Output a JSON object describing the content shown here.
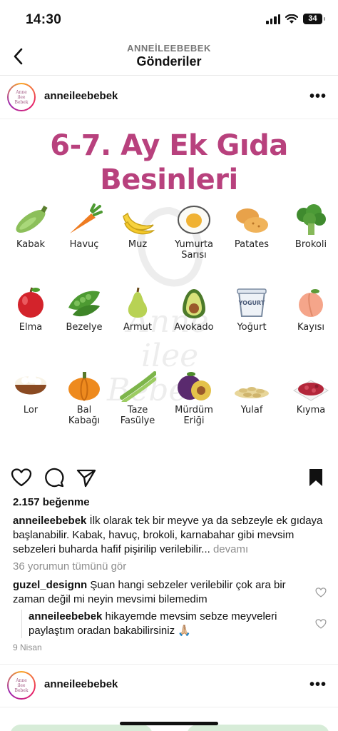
{
  "status": {
    "time": "14:30",
    "battery": "34"
  },
  "nav": {
    "account": "ANNEİLEEBEBEK",
    "title": "Gönderiler"
  },
  "post": {
    "username": "anneileebebek",
    "more_icon": "•••",
    "avatar_text": [
      "Anne",
      "ilee",
      "Bebek"
    ],
    "image": {
      "title_line1": "6-7. Ay Ek Gıda",
      "title_line2": "Besinleri",
      "watermark": [
        "Anne",
        "ilee",
        "Bebek"
      ],
      "foods": [
        {
          "label": "Kabak",
          "icon": "zucchini-icon"
        },
        {
          "label": "Havuç",
          "icon": "carrot-icon"
        },
        {
          "label": "Muz",
          "icon": "banana-icon"
        },
        {
          "label": "Yumurta\nSarısı",
          "icon": "egg-icon"
        },
        {
          "label": "Patates",
          "icon": "potato-icon"
        },
        {
          "label": "Brokoli",
          "icon": "broccoli-icon"
        },
        {
          "label": "Elma",
          "icon": "apple-icon"
        },
        {
          "label": "Bezelye",
          "icon": "peas-icon"
        },
        {
          "label": "Armut",
          "icon": "pear-icon"
        },
        {
          "label": "Avokado",
          "icon": "avocado-icon"
        },
        {
          "label": "Yoğurt",
          "icon": "yogurt-icon"
        },
        {
          "label": "Kayısı",
          "icon": "apricot-icon"
        },
        {
          "label": "Lor",
          "icon": "cottage-cheese-icon"
        },
        {
          "label": "Bal\nKabağı",
          "icon": "pumpkin-icon"
        },
        {
          "label": "Taze\nFasülye",
          "icon": "green-beans-icon"
        },
        {
          "label": "Mürdüm\nEriği",
          "icon": "plum-icon"
        },
        {
          "label": "Yulaf",
          "icon": "oats-icon"
        },
        {
          "label": "Kıyma",
          "icon": "minced-meat-icon"
        }
      ],
      "yogurt_text": "YOGURT"
    },
    "likes": "2.157 beğenme",
    "caption_user": "anneileebebek",
    "caption_text": " İlk olarak tek bir meyve ya da sebzeyle ek gıdaya başlanabilir. Kabak, havuç, brokoli, karnabahar gibi mevsim sebzeleri buharda hafif pişirilip verilebilir...",
    "caption_more": " devamı",
    "all_comments": "36 yorumun tümünü gör",
    "comments": [
      {
        "user": "guzel_designn",
        "text": " Şuan hangi sebzeler verilebilir çok ara bir zaman değil mi neyin mevsimi bilemedim"
      },
      {
        "user": "anneileebebek",
        "text": " hikayemde mevsim sebze meyveleri paylaştım oradan bakabilirsiniz 🙏🏼"
      }
    ],
    "date": "9 Nisan"
  },
  "next_post": {
    "username": "anneileebebek",
    "more_icon": "•••"
  }
}
